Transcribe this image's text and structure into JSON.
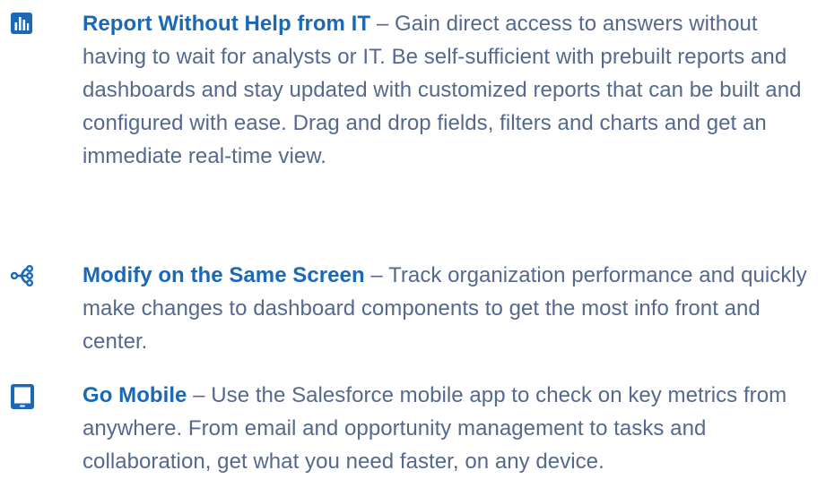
{
  "features": [
    {
      "icon": "bar-chart-icon",
      "title": "Report Without Help from IT",
      "separator": " – ",
      "description": "Gain direct access to answers without having to wait for analysts or IT. Be self-sufficient with prebuilt reports and dashboards and stay updated with customized reports that can be built and configured with ease. Drag and drop fields, filters and charts and get an immediate real-time view."
    },
    {
      "icon": "network-nodes-icon",
      "title": "Modify on the Same Screen",
      "separator": " – ",
      "description": "Track organization performance and quickly make changes to dashboard components to get the most info front and center."
    },
    {
      "icon": "mobile-device-icon",
      "title": "Go Mobile",
      "separator": " – ",
      "description": "Use the Salesforce mobile app to check on key metrics from anywhere. From email and opportunity management to tasks and collaboration, get what you need faster, on any device."
    }
  ],
  "colors": {
    "accent": "#1b69b5",
    "body_text": "#54698d"
  }
}
